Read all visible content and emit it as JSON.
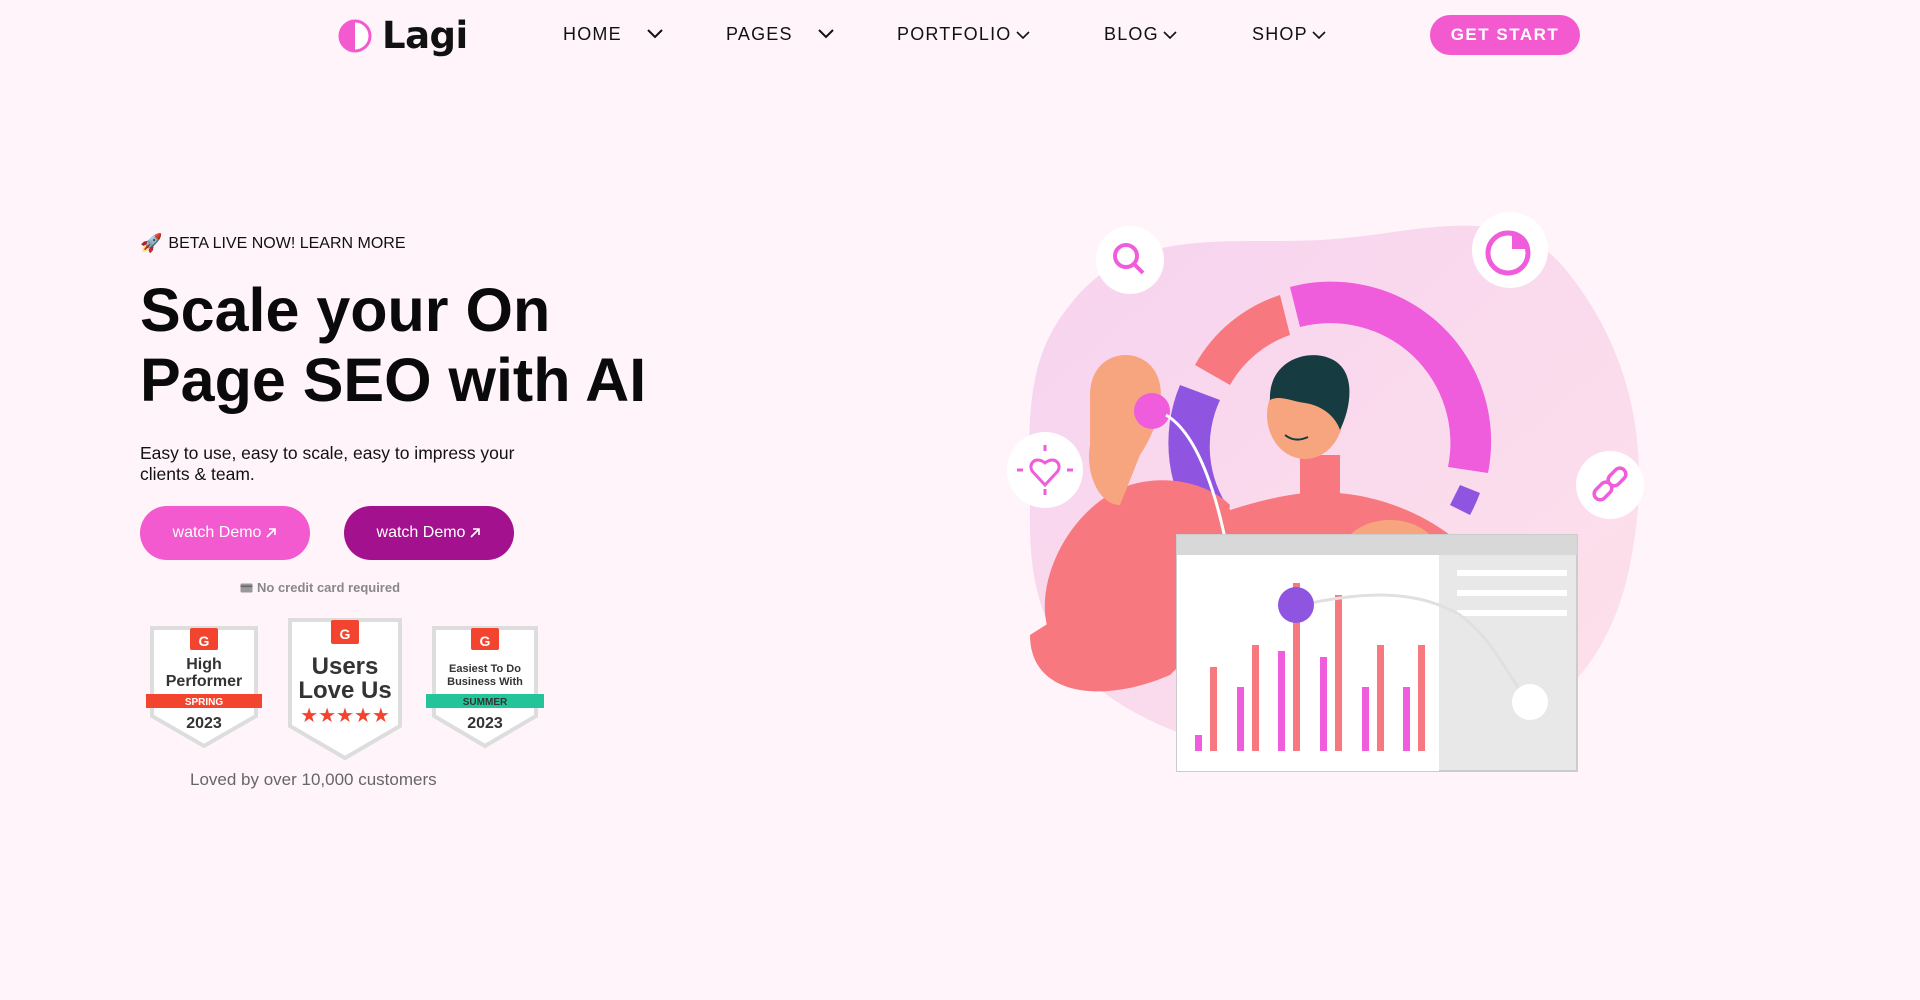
{
  "brand": {
    "name": "Lagi"
  },
  "nav": {
    "items": [
      {
        "label": "HOME"
      },
      {
        "label": "PAGES"
      },
      {
        "label": "PORTFOLIO"
      },
      {
        "label": "BLOG"
      },
      {
        "label": "SHOP"
      }
    ],
    "cta_label": "GET START"
  },
  "hero": {
    "beta_text": "BETA LIVE NOW! LEARN MORE",
    "headline_line1": "Scale your On",
    "headline_line2": "Page SEO with AI",
    "subtext": "Easy to use, easy to scale, easy to impress your clients & team.",
    "button1_label": "watch Demo",
    "button2_label": "watch Demo",
    "no_credit_card": "No credit card required",
    "loved_text": "Loved by over 10,000 customers"
  },
  "badges": [
    {
      "line1": "High",
      "line2": "Performer",
      "ribbon": "SPRING",
      "year": "2023",
      "ribbon_color": "#f2442e"
    },
    {
      "line1": "Users",
      "line2": "Love Us",
      "ribbon": "",
      "year": "",
      "ribbon_color": "#f2442e"
    },
    {
      "line1": "Easiest To Do",
      "line2": "Business With",
      "ribbon": "SUMMER",
      "year": "2023",
      "ribbon_color": "#23c49a"
    }
  ],
  "colors": {
    "accent": "#f45ad0",
    "accent_dark": "#a3118f",
    "background": "#fff4fa",
    "g2_red": "#f2442e"
  },
  "icons": [
    "rocket-icon",
    "search-icon",
    "pie-chart-icon",
    "heart-icon",
    "link-icon",
    "arrow-up-right-icon",
    "card-icon"
  ]
}
